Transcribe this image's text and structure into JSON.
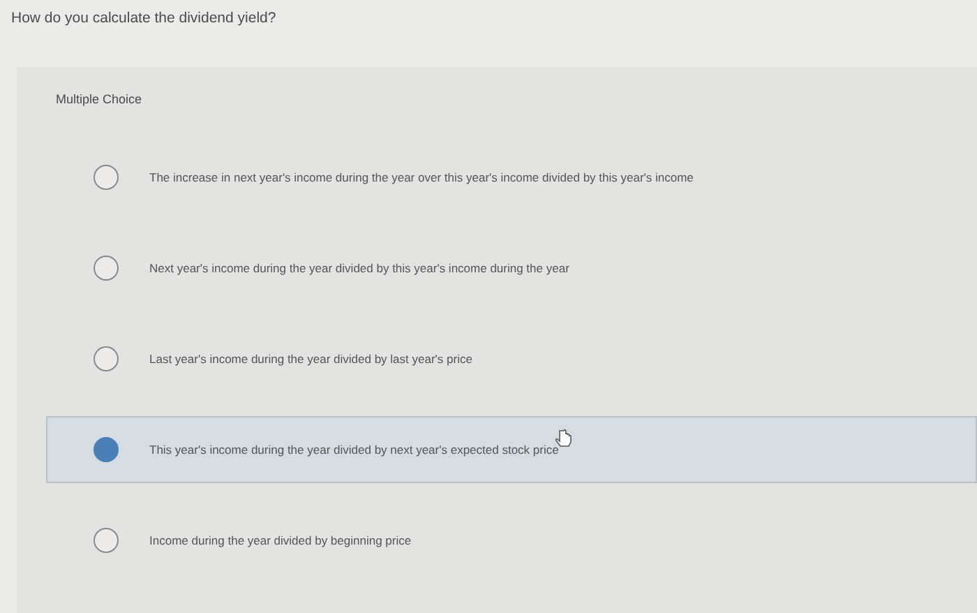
{
  "question": "How do you calculate the dividend yield?",
  "panel": {
    "label": "Multiple Choice",
    "options": [
      {
        "text": "The increase in next year's income during the year over this year's income divided by this year's income",
        "selected": false
      },
      {
        "text": "Next year's income during the year divided by this year's income during the year",
        "selected": false
      },
      {
        "text": "Last year's income during the year divided by last year's price",
        "selected": false
      },
      {
        "text": "This year's income during the year divided by next year's expected stock price",
        "selected": true
      },
      {
        "text": "Income during the year divided by beginning price",
        "selected": false
      }
    ]
  }
}
